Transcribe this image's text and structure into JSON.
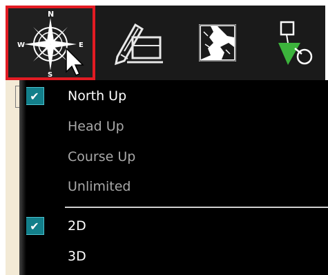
{
  "toolbar": {
    "compass": {
      "icon": "compass-rose-icon",
      "letters": {
        "n": "N",
        "e": "E",
        "s": "S",
        "w": "W"
      }
    },
    "tools": [
      {
        "icon": "pencil-notes-icon"
      },
      {
        "icon": "chart-map-icon"
      },
      {
        "icon": "target-waypoint-icon"
      }
    ],
    "highlight_color": "#e21b23"
  },
  "menu": {
    "orientation_items": [
      {
        "label": "North Up",
        "checked": true
      },
      {
        "label": "Head Up",
        "checked": false
      },
      {
        "label": "Course Up",
        "checked": false
      },
      {
        "label": "Unlimited",
        "checked": false
      }
    ],
    "view_items": [
      {
        "label": "2D",
        "checked": true
      },
      {
        "label": "3D",
        "checked": false
      }
    ],
    "check_glyph": "✔",
    "check_color": "#137f8a"
  }
}
